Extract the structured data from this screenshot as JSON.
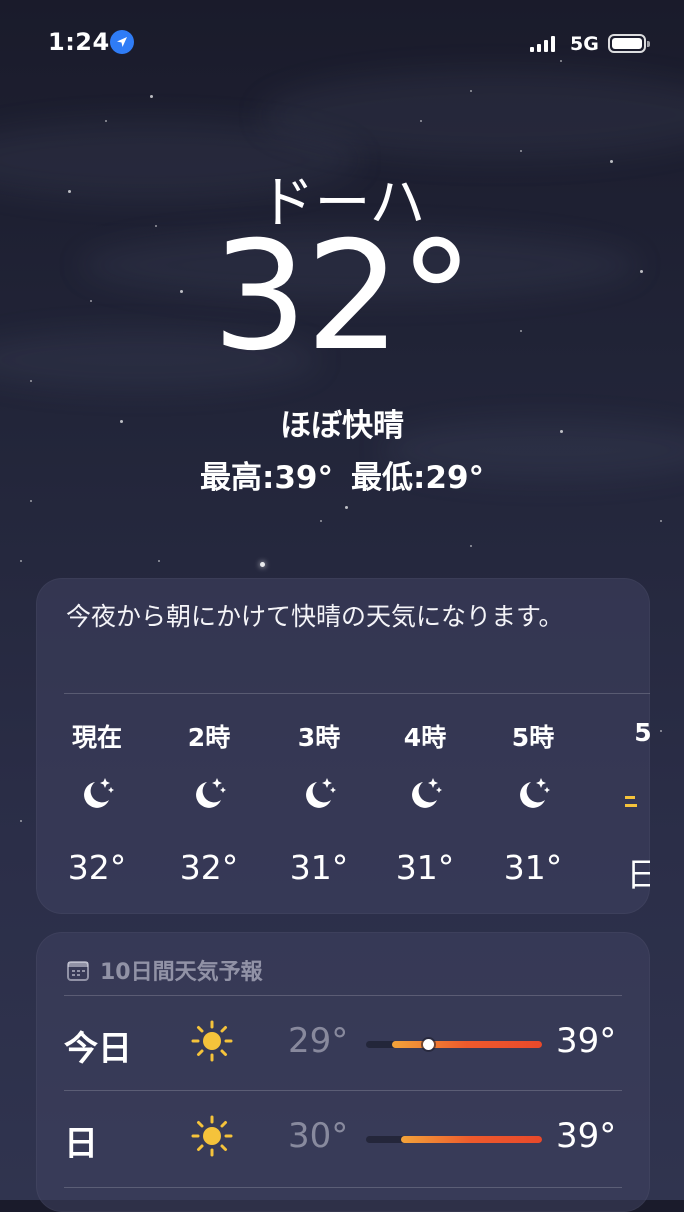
{
  "status_bar": {
    "time": "1:24",
    "network": "5G"
  },
  "location": {
    "city": "ドーハ",
    "temperature": "32°",
    "condition": "ほぼ快晴",
    "high": "最高:39°",
    "low": "最低:29°"
  },
  "hourly_card": {
    "summary": "今夜から朝にかけて快晴の天気になります。",
    "hours": [
      {
        "label": "現在",
        "icon": "moon-stars-icon",
        "temp": "32°"
      },
      {
        "label": "2時",
        "icon": "moon-stars-icon",
        "temp": "32°"
      },
      {
        "label": "3時",
        "icon": "moon-stars-icon",
        "temp": "31°"
      },
      {
        "label": "4時",
        "icon": "moon-stars-icon",
        "temp": "31°"
      },
      {
        "label": "5時",
        "icon": "moon-stars-icon",
        "temp": "31°"
      },
      {
        "label": "5",
        "icon": "sunrise-icon",
        "temp": "日"
      }
    ]
  },
  "forecast_card": {
    "title": "10日間天気予報",
    "days": [
      {
        "day": "今日",
        "icon": "sun-icon",
        "low": "29°",
        "high": "39°",
        "range_start": 0.15,
        "range_end": 1.0,
        "current_marker": 0.35
      },
      {
        "day": "日",
        "icon": "sun-icon",
        "low": "30°",
        "high": "39°",
        "range_start": 0.2,
        "range_end": 1.0
      }
    ]
  },
  "colors": {
    "accent_location": "#2f7cf6",
    "range_warm": "#ee5a2c",
    "range_start": "#f2a33a"
  }
}
